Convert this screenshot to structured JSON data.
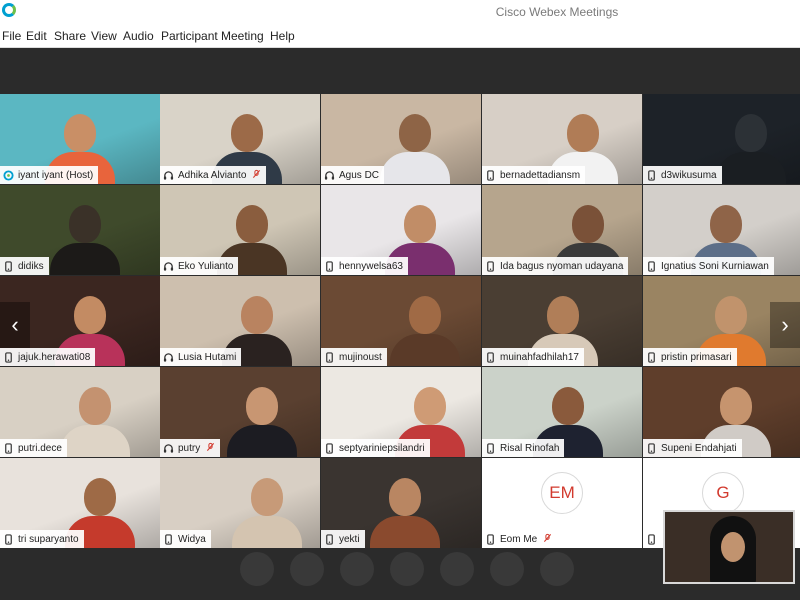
{
  "window": {
    "title": "Cisco Webex Meetings"
  },
  "menu": [
    "File",
    "Edit",
    "Share",
    "View",
    "Audio",
    "Participant",
    "Meeting",
    "Help"
  ],
  "participants": [
    {
      "name": "iyant iyant",
      "suffix": "(Host)",
      "muted": false,
      "icon": "webex-icon",
      "bg": "#5bb7c2",
      "skin": "#c98f66",
      "shirt": "#e8643c"
    },
    {
      "name": "Adhika Alvianto",
      "muted": true,
      "icon": "headset-icon",
      "bg": "#d9d3c8",
      "skin": "#9c6a48",
      "shirt": "#2f3a47"
    },
    {
      "name": "Agus DC",
      "muted": false,
      "icon": "headset-icon",
      "bg": "#c9b7a3",
      "skin": "#8e6446",
      "shirt": "#e6e6ea"
    },
    {
      "name": "bernadettadiansm",
      "muted": false,
      "icon": "phone-icon",
      "bg": "#d7cfc6",
      "skin": "#b07c56",
      "shirt": "#f2f2f2"
    },
    {
      "name": "d3wikusuma",
      "muted": false,
      "icon": "phone-icon",
      "bg": "#1d2228",
      "skin": "#2c3136",
      "shirt": "#1a1e22"
    },
    {
      "name": "didiks",
      "muted": false,
      "icon": "phone-icon",
      "bg": "#3f4a2b",
      "skin": "#3a3128",
      "shirt": "#1c1a18"
    },
    {
      "name": "Eko Yulianto",
      "muted": false,
      "icon": "headset-icon",
      "bg": "#cfc6b5",
      "skin": "#8a5d3e",
      "shirt": "#4a3524"
    },
    {
      "name": "hennywelsa63",
      "muted": false,
      "icon": "phone-icon",
      "bg": "#e9e6e8",
      "skin": "#c18d67",
      "shirt": "#7a2f6e"
    },
    {
      "name": "Ida bagus nyoman udayana",
      "muted": false,
      "icon": "phone-icon",
      "bg": "#b6a58d",
      "skin": "#7a5138",
      "shirt": "#3a3a3a"
    },
    {
      "name": "Ignatius Soni Kurniawan",
      "muted": false,
      "icon": "phone-icon",
      "bg": "#d3cfca",
      "skin": "#8f6448",
      "shirt": "#5c6e88"
    },
    {
      "name": "jajuk.herawati08",
      "muted": false,
      "icon": "phone-icon",
      "bg": "#3b2620",
      "skin": "#c38b63",
      "shirt": "#b8325a"
    },
    {
      "name": "Lusia Hutami",
      "muted": false,
      "icon": "headset-icon",
      "bg": "#cdbfae",
      "skin": "#b98360",
      "shirt": "#2a2220"
    },
    {
      "name": "mujinoust",
      "muted": false,
      "icon": "phone-icon",
      "bg": "#6b4a34",
      "skin": "#a06a45",
      "shirt": "#5a3a28"
    },
    {
      "name": "muinahfadhilah17",
      "muted": false,
      "icon": "phone-icon",
      "bg": "#4a3e33",
      "skin": "#b07e58",
      "shirt": "#d7c9b8"
    },
    {
      "name": "pristin primasari",
      "muted": false,
      "icon": "phone-icon",
      "bg": "#9a8462",
      "skin": "#c1936c",
      "shirt": "#e07a2e"
    },
    {
      "name": "putri.dece",
      "muted": false,
      "icon": "phone-icon",
      "bg": "#d8d0c4",
      "skin": "#c49270",
      "shirt": "#ded4c6"
    },
    {
      "name": "putry",
      "muted": true,
      "icon": "headset-icon",
      "bg": "#5a4030",
      "skin": "#c89672",
      "shirt": "#1c1c22"
    },
    {
      "name": "septyariniepsilandri",
      "muted": false,
      "icon": "phone-icon",
      "bg": "#ece8e2",
      "skin": "#cf9b75",
      "shirt": "#c23a3a"
    },
    {
      "name": "Risal Rinofah",
      "muted": false,
      "icon": "phone-icon",
      "bg": "#cbd2c9",
      "skin": "#8a5a3c",
      "shirt": "#1e2230"
    },
    {
      "name": "Supeni Endahjati",
      "muted": false,
      "icon": "phone-icon",
      "bg": "#5f3e2b",
      "skin": "#c6946e",
      "shirt": "#d0cbc6"
    },
    {
      "name": "tri suparyanto",
      "muted": false,
      "icon": "phone-icon",
      "bg": "#e8e2dc",
      "skin": "#9e6a46",
      "shirt": "#c53a2c"
    },
    {
      "name": "Widya",
      "muted": false,
      "icon": "phone-icon",
      "bg": "#d8cfc4",
      "skin": "#c79a78",
      "shirt": "#d4c4b0"
    },
    {
      "name": "yekti",
      "muted": false,
      "icon": "phone-icon",
      "bg": "#3a3430",
      "skin": "#b98662",
      "shirt": "#8a4a2e"
    },
    {
      "name": "Eom Me",
      "muted": true,
      "icon": "phone-icon",
      "avatar": "EM"
    },
    {
      "name": "",
      "muted": false,
      "icon": "phone-icon",
      "avatar": "G"
    }
  ],
  "nav": {
    "prev": "‹",
    "next": "›"
  },
  "colors": {
    "accent": "#d23a2e",
    "webex": "#00a0d1"
  }
}
